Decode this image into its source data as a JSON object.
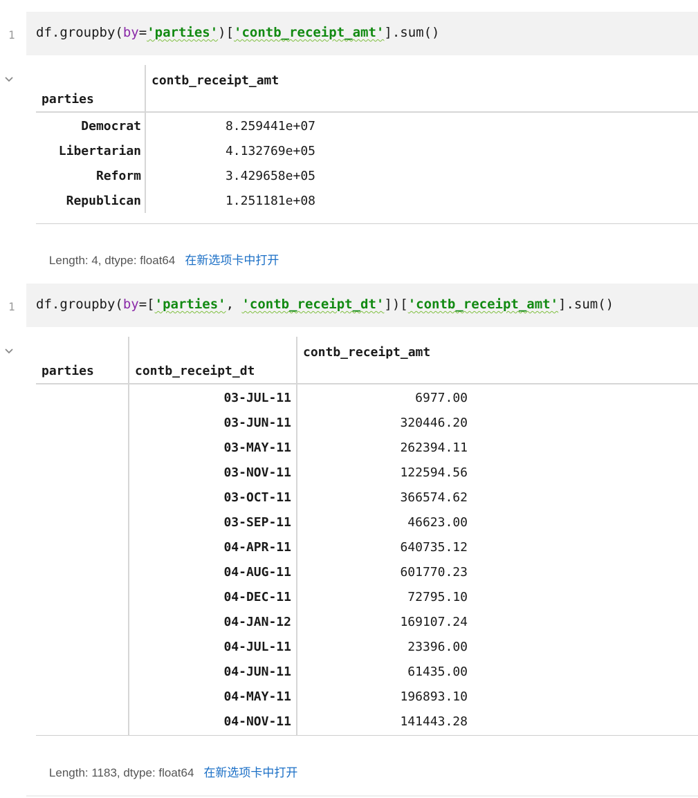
{
  "cells": [
    {
      "line_number": "1",
      "code_tokens": [
        {
          "t": "df.groupby(",
          "c": ""
        },
        {
          "t": "by",
          "c": "kw"
        },
        {
          "t": "=",
          "c": ""
        },
        {
          "t": "'parties'",
          "c": "str"
        },
        {
          "t": ")[",
          "c": ""
        },
        {
          "t": "'contb_receipt_amt'",
          "c": "str"
        },
        {
          "t": "].sum()",
          "c": ""
        }
      ],
      "table": {
        "index_header": "parties",
        "value_header": "contb_receipt_amt",
        "rows": [
          {
            "index": "Democrat",
            "value": "8.259441e+07"
          },
          {
            "index": "Libertarian",
            "value": "4.132769e+05"
          },
          {
            "index": "Reform",
            "value": "3.429658e+05"
          },
          {
            "index": "Republican",
            "value": "1.251181e+08"
          }
        ]
      },
      "footer": {
        "text": "Length: 4, dtype: float64",
        "link": "在新选项卡中打开"
      }
    },
    {
      "line_number": "1",
      "code_tokens": [
        {
          "t": "df.groupby(",
          "c": ""
        },
        {
          "t": "by",
          "c": "kw"
        },
        {
          "t": "=[",
          "c": ""
        },
        {
          "t": "'parties'",
          "c": "str"
        },
        {
          "t": ", ",
          "c": ""
        },
        {
          "t": "'contb_receipt_dt'",
          "c": "str"
        },
        {
          "t": "])[",
          "c": ""
        },
        {
          "t": "'contb_receipt_amt'",
          "c": "str"
        },
        {
          "t": "].sum()",
          "c": ""
        }
      ],
      "table": {
        "index_header_1": "parties",
        "index_header_2": "contb_receipt_dt",
        "value_header": "contb_receipt_amt",
        "rows": [
          {
            "index": "03-JUL-11",
            "value": "6977.00"
          },
          {
            "index": "03-JUN-11",
            "value": "320446.20"
          },
          {
            "index": "03-MAY-11",
            "value": "262394.11"
          },
          {
            "index": "03-NOV-11",
            "value": "122594.56"
          },
          {
            "index": "03-OCT-11",
            "value": "366574.62"
          },
          {
            "index": "03-SEP-11",
            "value": "46623.00"
          },
          {
            "index": "04-APR-11",
            "value": "640735.12"
          },
          {
            "index": "04-AUG-11",
            "value": "601770.23"
          },
          {
            "index": "04-DEC-11",
            "value": "72795.10"
          },
          {
            "index": "04-JAN-12",
            "value": "169107.24"
          },
          {
            "index": "04-JUL-11",
            "value": "23396.00"
          },
          {
            "index": "04-JUN-11",
            "value": "61435.00"
          },
          {
            "index": "04-MAY-11",
            "value": "196893.10"
          },
          {
            "index": "04-NOV-11",
            "value": "141443.28"
          }
        ]
      },
      "footer": {
        "text": "Length: 1183, dtype: float64",
        "link": "在新选项卡中打开"
      }
    }
  ],
  "colors": {
    "keyword": "#8a2aa8",
    "string": "#128a12",
    "link": "#1b6fc6",
    "code_background": "#f2f2f2"
  },
  "icons": [
    "chevron-down-icon"
  ]
}
